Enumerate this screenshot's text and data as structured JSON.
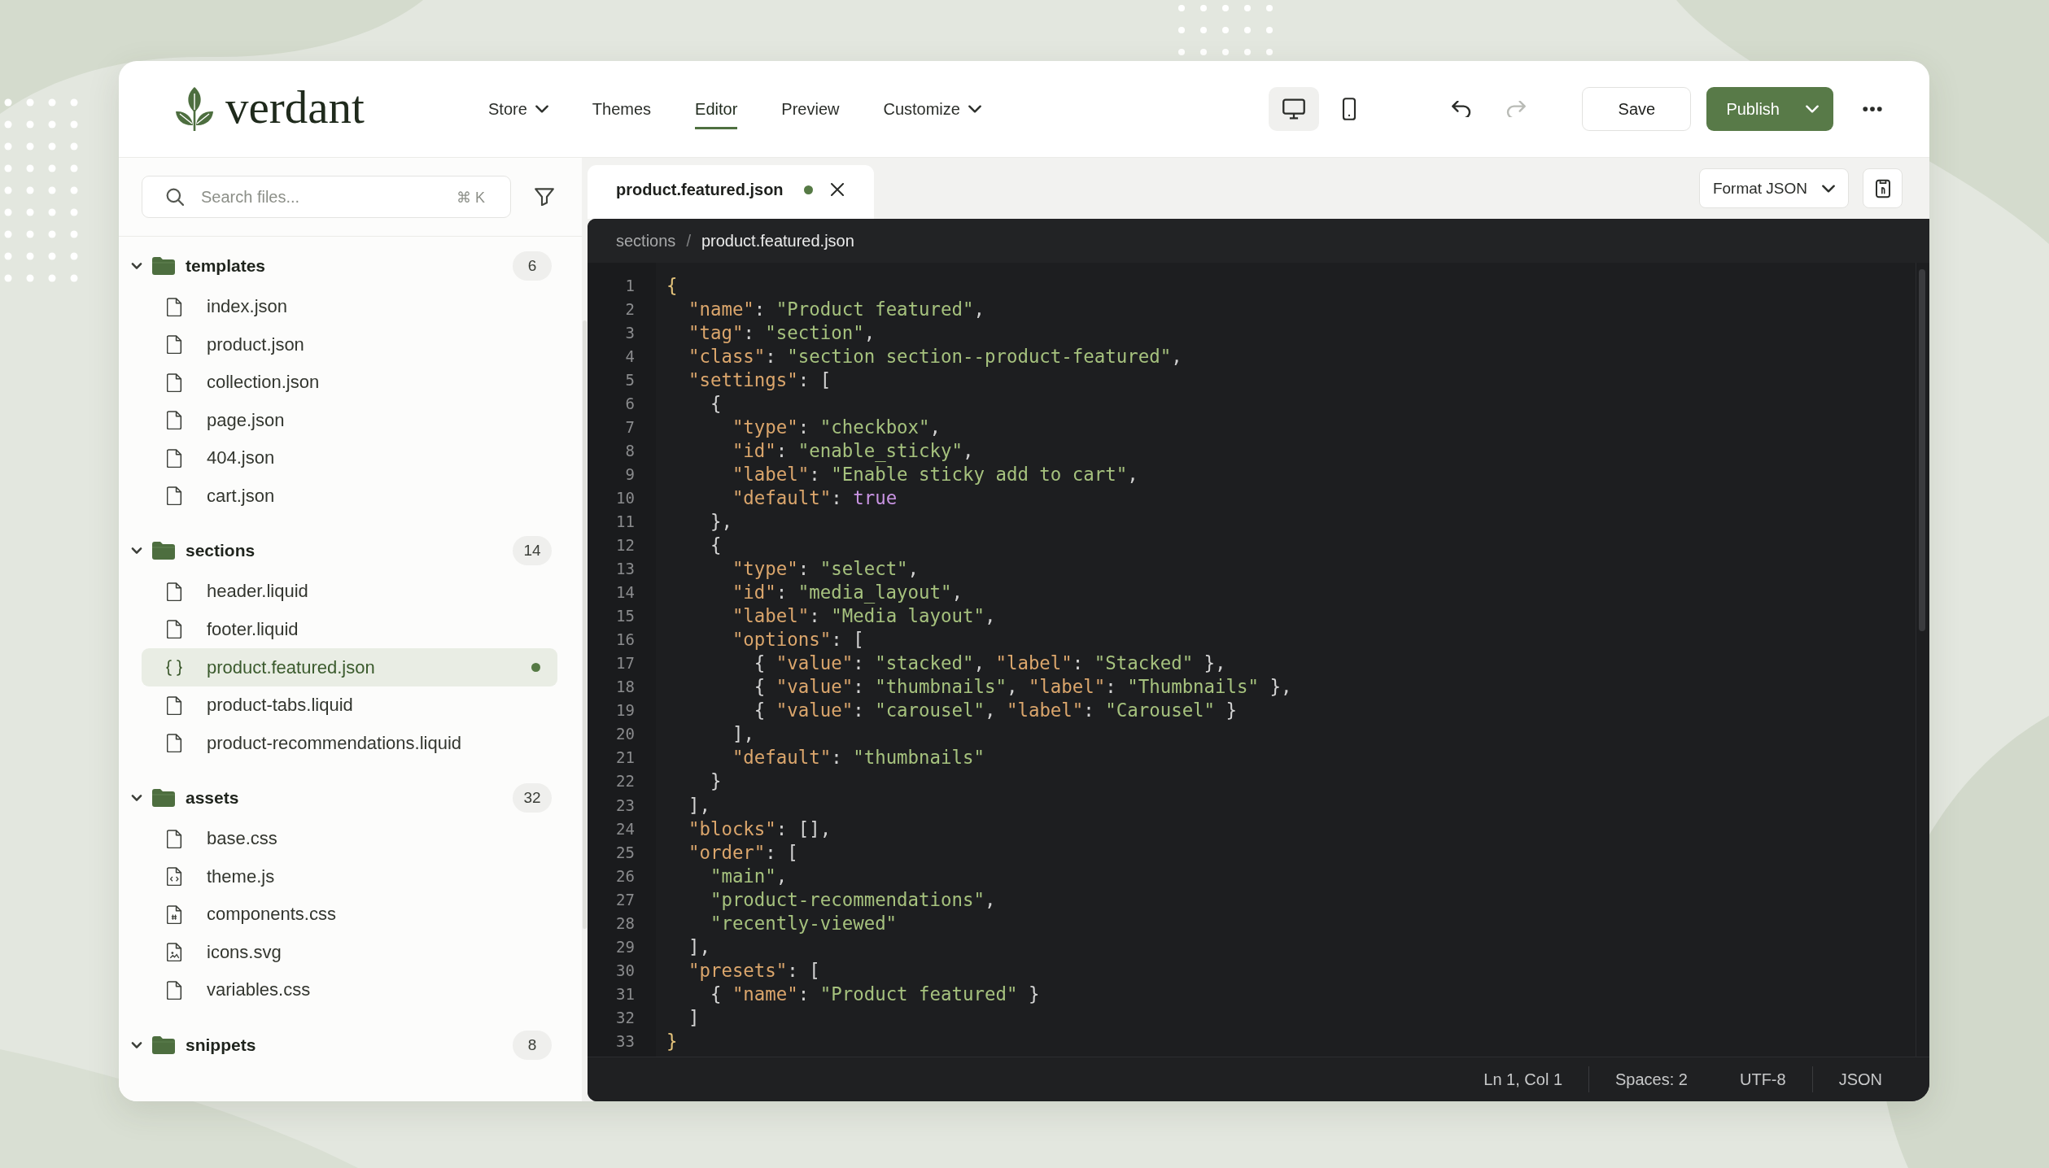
{
  "brand": {
    "name": "verdant"
  },
  "nav": [
    {
      "label": "Store",
      "has_menu": true,
      "selected": false
    },
    {
      "label": "Themes",
      "has_menu": false,
      "selected": false
    },
    {
      "label": "Editor",
      "has_menu": false,
      "selected": true
    },
    {
      "label": "Preview",
      "has_menu": false,
      "selected": false
    },
    {
      "label": "Customize",
      "has_menu": true,
      "selected": false
    }
  ],
  "device_toggle": [
    {
      "kind": "desktop",
      "selected": true
    },
    {
      "kind": "mobile",
      "selected": false
    }
  ],
  "history": [
    {
      "kind": "undo",
      "disabled": false
    },
    {
      "kind": "redo",
      "disabled": true
    }
  ],
  "save_button": {
    "label": "Save"
  },
  "publish_button": {
    "label": "Publish"
  },
  "sidebar": {
    "search": {
      "placeholder": "Search files...",
      "shortcut": "⌘ K"
    },
    "tree": [
      {
        "name": "templates",
        "count": "6",
        "expanded": true,
        "children": [
          {
            "name": "index.json",
            "kind": "document",
            "selected": false,
            "modified": false
          },
          {
            "name": "product.json",
            "kind": "document",
            "selected": false,
            "modified": false
          },
          {
            "name": "collection.json",
            "kind": "document",
            "selected": false,
            "modified": false
          },
          {
            "name": "page.json",
            "kind": "document",
            "selected": false,
            "modified": false
          },
          {
            "name": "404.json",
            "kind": "document",
            "selected": false,
            "modified": false
          },
          {
            "name": "cart.json",
            "kind": "document",
            "selected": false,
            "modified": false
          }
        ]
      },
      {
        "name": "sections",
        "count": "14",
        "expanded": true,
        "children": [
          {
            "name": "header.liquid",
            "kind": "document",
            "selected": false,
            "modified": false
          },
          {
            "name": "footer.liquid",
            "kind": "document",
            "selected": false,
            "modified": false
          },
          {
            "name": "product.featured.json",
            "kind": "braces",
            "selected": true,
            "modified": true
          },
          {
            "name": "product-tabs.liquid",
            "kind": "document",
            "selected": false,
            "modified": false
          },
          {
            "name": "product-recommendations.liquid",
            "kind": "document",
            "selected": false,
            "modified": false
          }
        ]
      },
      {
        "name": "assets",
        "count": "32",
        "expanded": true,
        "children": [
          {
            "name": "base.css",
            "kind": "document",
            "selected": false,
            "modified": false
          },
          {
            "name": "theme.js",
            "kind": "script",
            "selected": false,
            "modified": false
          },
          {
            "name": "components.css",
            "kind": "stylesheet",
            "selected": false,
            "modified": false
          },
          {
            "name": "icons.svg",
            "kind": "image",
            "selected": false,
            "modified": false
          },
          {
            "name": "variables.css",
            "kind": "document",
            "selected": false,
            "modified": false
          }
        ]
      },
      {
        "name": "snippets",
        "count": "8",
        "expanded": true
      }
    ]
  },
  "editor": {
    "tabs": [
      {
        "label": "product.featured.json",
        "modified": true,
        "selected": true
      }
    ],
    "format_menu": {
      "label": "Format JSON"
    },
    "breadcrumb": {
      "parts": [
        "sections",
        "product.featured.json"
      ],
      "separator": "/"
    },
    "lines": [
      {
        "number": "1",
        "code": "{"
      },
      {
        "number": "2",
        "code": "  \"name\": \"Product featured\","
      },
      {
        "number": "3",
        "code": "  \"tag\": \"section\","
      },
      {
        "number": "4",
        "code": "  \"class\": \"section section--product-featured\","
      },
      {
        "number": "5",
        "code": "  \"settings\": ["
      },
      {
        "number": "6",
        "code": "    {"
      },
      {
        "number": "7",
        "code": "      \"type\": \"checkbox\","
      },
      {
        "number": "8",
        "code": "      \"id\": \"enable_sticky\","
      },
      {
        "number": "9",
        "code": "      \"label\": \"Enable sticky add to cart\","
      },
      {
        "number": "10",
        "code": "      \"default\": true"
      },
      {
        "number": "11",
        "code": "    },"
      },
      {
        "number": "12",
        "code": "    {"
      },
      {
        "number": "13",
        "code": "      \"type\": \"select\","
      },
      {
        "number": "14",
        "code": "      \"id\": \"media_layout\","
      },
      {
        "number": "15",
        "code": "      \"label\": \"Media layout\","
      },
      {
        "number": "16",
        "code": "      \"options\": ["
      },
      {
        "number": "17",
        "code": "        { \"value\": \"stacked\", \"label\": \"Stacked\" },"
      },
      {
        "number": "18",
        "code": "        { \"value\": \"thumbnails\", \"label\": \"Thumbnails\" },"
      },
      {
        "number": "19",
        "code": "        { \"value\": \"carousel\", \"label\": \"Carousel\" }"
      },
      {
        "number": "20",
        "code": "      ],"
      },
      {
        "number": "21",
        "code": "      \"default\": \"thumbnails\""
      },
      {
        "number": "22",
        "code": "    }"
      },
      {
        "number": "23",
        "code": "  ],"
      },
      {
        "number": "24",
        "code": "  \"blocks\": [],"
      },
      {
        "number": "25",
        "code": "  \"order\": ["
      },
      {
        "number": "26",
        "code": "    \"main\","
      },
      {
        "number": "27",
        "code": "    \"product-recommendations\","
      },
      {
        "number": "28",
        "code": "    \"recently-viewed\""
      },
      {
        "number": "29",
        "code": "  ],"
      },
      {
        "number": "30",
        "code": "  \"presets\": ["
      },
      {
        "number": "31",
        "code": "    { \"name\": \"Product featured\" }"
      },
      {
        "number": "32",
        "code": "  ]"
      },
      {
        "number": "33",
        "code": "}"
      }
    ],
    "status_bar": [
      {
        "text": "Ln 1, Col 1",
        "divider_after": true
      },
      {
        "text": "Spaces: 2",
        "divider_after": false
      },
      {
        "text": "UTF-8",
        "divider_after": true
      },
      {
        "text": "JSON",
        "divider_after": false
      }
    ]
  }
}
